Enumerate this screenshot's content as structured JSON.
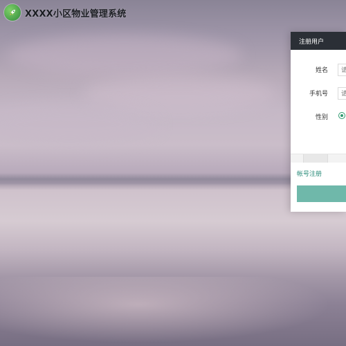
{
  "app": {
    "title": "XXXX小区物业管理系统",
    "logo_icon": "rocket-icon"
  },
  "register_panel": {
    "title": "注册用户",
    "fields": [
      {
        "label": "姓名",
        "placeholder": "请"
      },
      {
        "label": "手机号",
        "placeholder": "请"
      }
    ],
    "gender_label": "性别",
    "account_register_link": "帐号注册",
    "submit_label": ""
  },
  "colors": {
    "header_bg": "#2b2f36",
    "accent_green": "#2e9a6f",
    "button": "#6fb8aa",
    "link": "#2a8c7a"
  }
}
